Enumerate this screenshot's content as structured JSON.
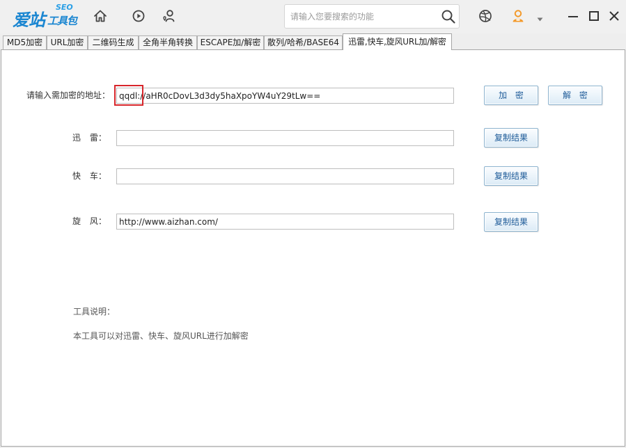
{
  "colors": {
    "brand": "#1b86d1",
    "highlight_border": "#d7262b",
    "button_text": "#1f5c99",
    "avatar": "#f39a2b"
  },
  "header": {
    "logo": {
      "main": "爱站",
      "sub": "工具包",
      "badge": "SEO"
    },
    "nav_icons": [
      "home-icon",
      "play-circle-icon",
      "user-location-icon"
    ],
    "search": {
      "placeholder": "请输入您要搜索的功能",
      "icon": "search-icon"
    },
    "right_icons": [
      "globe-icon",
      "user-avatar-icon",
      "chevron-down-icon"
    ],
    "window_controls": [
      "minimize-icon",
      "maximize-icon",
      "close-icon"
    ]
  },
  "tabs": [
    {
      "label": "MD5加密",
      "active": false
    },
    {
      "label": "URL加密",
      "active": false
    },
    {
      "label": "二维码生成",
      "active": false
    },
    {
      "label": "全角半角转换",
      "active": false
    },
    {
      "label": "ESCAPE加/解密",
      "active": false
    },
    {
      "label": "散列/哈希/BASE64",
      "active": false
    },
    {
      "label": "迅雷,快车,旋风URL加/解密",
      "active": true
    }
  ],
  "form": {
    "source": {
      "label": "请输入需加密的地址：",
      "value": "qqdl://aHR0cDovL3d3dy5haXpoYW4uY29tLw=="
    },
    "encrypt_button": "加 密",
    "decrypt_button": "解 密",
    "results": [
      {
        "label": "迅 雷：",
        "value": "",
        "copy_button": "复制结果"
      },
      {
        "label": "快 车：",
        "value": "",
        "copy_button": "复制结果"
      },
      {
        "label": "旋 风：",
        "value": "http://www.aizhan.com/",
        "copy_button": "复制结果"
      }
    ]
  },
  "description": {
    "title": "工具说明：",
    "text": "本工具可以对迅雷、快车、旋风URL进行加解密"
  }
}
